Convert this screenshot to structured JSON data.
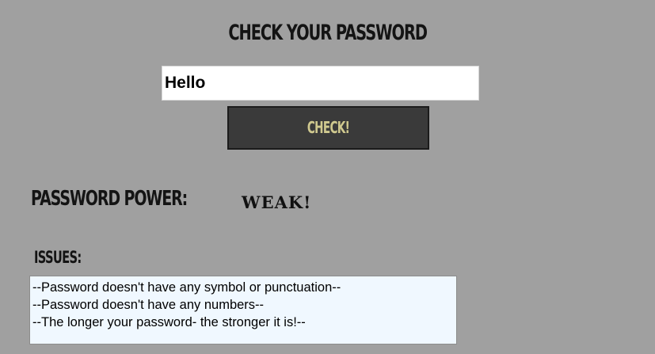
{
  "header": {
    "title": "CHECK YOUR PASSWORD"
  },
  "form": {
    "password_value": "Hello",
    "check_label": "CHECK!"
  },
  "result": {
    "power_label": "PASSWORD POWER:",
    "power_value": "WEAK!"
  },
  "issues": {
    "label": "ISSUES:",
    "items": [
      "--Password doesn't have any symbol or punctuation--",
      "--Password doesn't have any numbers--",
      "--The longer your password- the stronger it is!--"
    ]
  },
  "colors": {
    "background": "#a0a0a0",
    "button_bg": "#3a3a3a",
    "button_text": "#d0c98f",
    "issues_bg": "#f0f8ff"
  }
}
